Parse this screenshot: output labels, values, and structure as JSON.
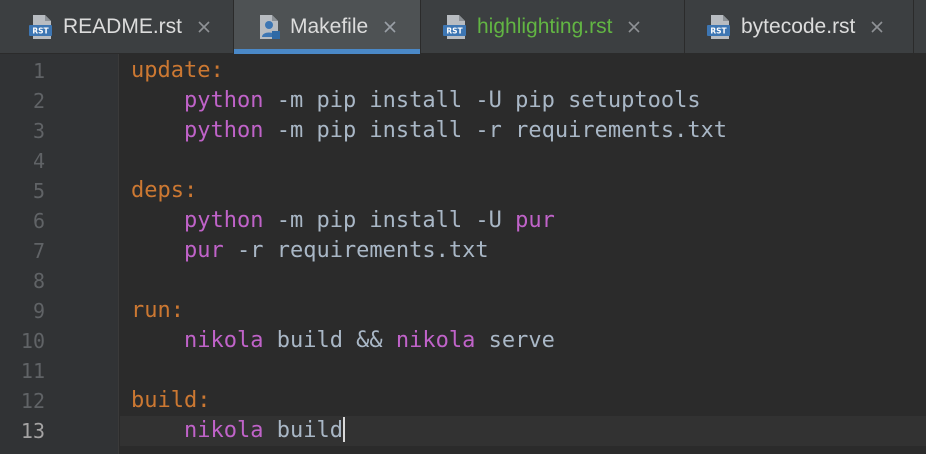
{
  "tabs": [
    {
      "name": "README.rst",
      "icon": "rst-file-icon",
      "active": false,
      "vcs_status": "none"
    },
    {
      "name": "Makefile",
      "icon": "makefile-icon",
      "active": true,
      "vcs_status": "none"
    },
    {
      "name": "highlighting.rst",
      "icon": "rst-file-icon",
      "active": false,
      "vcs_status": "added"
    },
    {
      "name": "bytecode.rst",
      "icon": "rst-file-icon",
      "active": false,
      "vcs_status": "none"
    }
  ],
  "rst_badge": "RST",
  "editor": {
    "current_line": 13,
    "lines": [
      {
        "number": "1",
        "tokens": [
          {
            "t": "update:",
            "k": "target"
          }
        ]
      },
      {
        "number": "2",
        "tokens": [
          {
            "t": "    ",
            "k": "plain"
          },
          {
            "t": "python",
            "k": "cmd"
          },
          {
            "t": " -m pip install -U pip setuptools",
            "k": "plain"
          }
        ]
      },
      {
        "number": "3",
        "tokens": [
          {
            "t": "    ",
            "k": "plain"
          },
          {
            "t": "python",
            "k": "cmd"
          },
          {
            "t": " -m pip install -r requirements.txt",
            "k": "plain"
          }
        ]
      },
      {
        "number": "4",
        "tokens": []
      },
      {
        "number": "5",
        "tokens": [
          {
            "t": "deps:",
            "k": "target"
          }
        ]
      },
      {
        "number": "6",
        "tokens": [
          {
            "t": "    ",
            "k": "plain"
          },
          {
            "t": "python",
            "k": "cmd"
          },
          {
            "t": " -m pip install -U ",
            "k": "plain"
          },
          {
            "t": "pur",
            "k": "cmd"
          }
        ]
      },
      {
        "number": "7",
        "tokens": [
          {
            "t": "    ",
            "k": "plain"
          },
          {
            "t": "pur",
            "k": "cmd"
          },
          {
            "t": " -r requirements.txt",
            "k": "plain"
          }
        ]
      },
      {
        "number": "8",
        "tokens": []
      },
      {
        "number": "9",
        "tokens": [
          {
            "t": "run:",
            "k": "target"
          }
        ]
      },
      {
        "number": "10",
        "tokens": [
          {
            "t": "    ",
            "k": "plain"
          },
          {
            "t": "nikola",
            "k": "cmd"
          },
          {
            "t": " build && ",
            "k": "plain"
          },
          {
            "t": "nikola",
            "k": "cmd"
          },
          {
            "t": " serve",
            "k": "plain"
          }
        ]
      },
      {
        "number": "11",
        "tokens": []
      },
      {
        "number": "12",
        "tokens": [
          {
            "t": "build:",
            "k": "target"
          }
        ]
      },
      {
        "number": "13",
        "tokens": [
          {
            "t": "    ",
            "k": "plain"
          },
          {
            "t": "nikola",
            "k": "cmd"
          },
          {
            "t": " build",
            "k": "plain"
          }
        ]
      }
    ]
  },
  "colors": {
    "background": "#2b2b2b",
    "gutter": "#313335",
    "tab_active_underline": "#4a88c7",
    "target": "#cc7832",
    "command": "#c063c9",
    "plain_text": "#a9b7c6",
    "vcs_added": "#62b543"
  }
}
